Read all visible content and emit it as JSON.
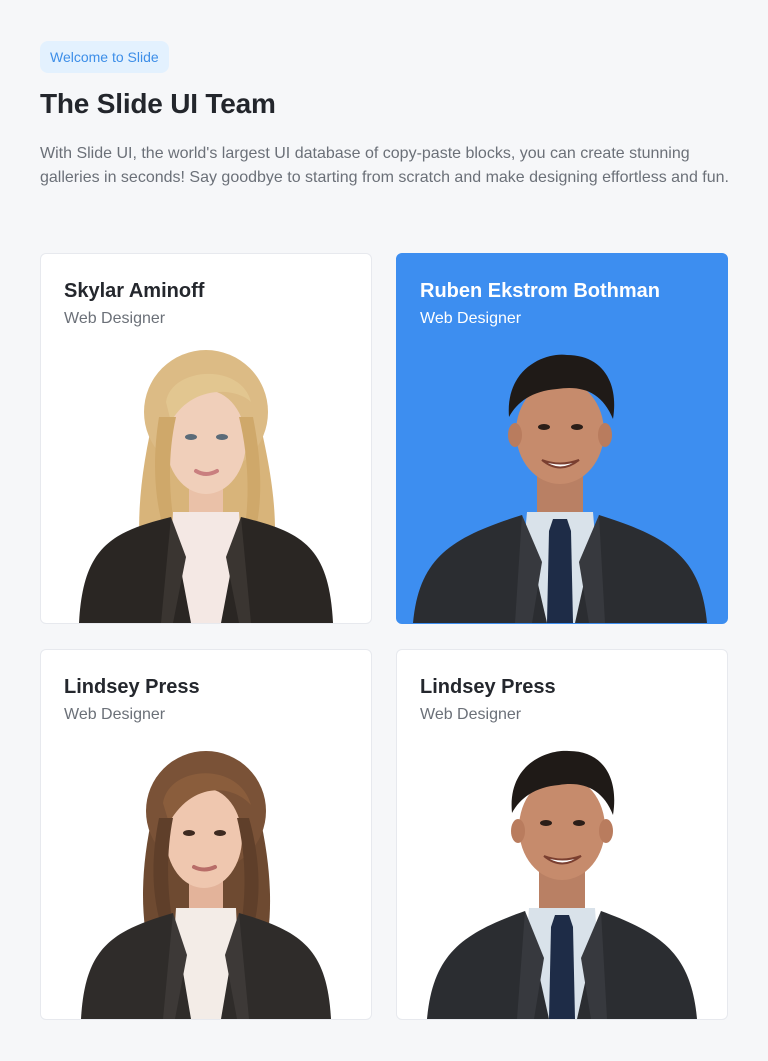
{
  "header": {
    "badge": "Welcome to Slide",
    "title": "The Slide UI Team",
    "description": "With Slide UI, the world's largest UI database of copy-paste blocks, you can create stunning galleries in seconds! Say goodbye to starting from scratch and make designing effortless and fun."
  },
  "team": [
    {
      "name": "Skylar Aminoff",
      "role": "Web Designer",
      "photo": "woman-blonde-portrait"
    },
    {
      "name": "Ruben Ekstrom Bothman",
      "role": "Web Designer",
      "photo": "man-suit-portrait"
    },
    {
      "name": "Lindsey Press",
      "role": "Web Designer",
      "photo": "woman-brunette-portrait"
    },
    {
      "name": "Lindsey Press",
      "role": "Web Designer",
      "photo": "man-suit-portrait"
    }
  ],
  "colors": {
    "accent": "#3d8ef0",
    "badge_bg": "#e3f1fe",
    "badge_text": "#3d8ee8",
    "page_bg": "#f6f7f9",
    "muted_text": "#6b7078"
  }
}
